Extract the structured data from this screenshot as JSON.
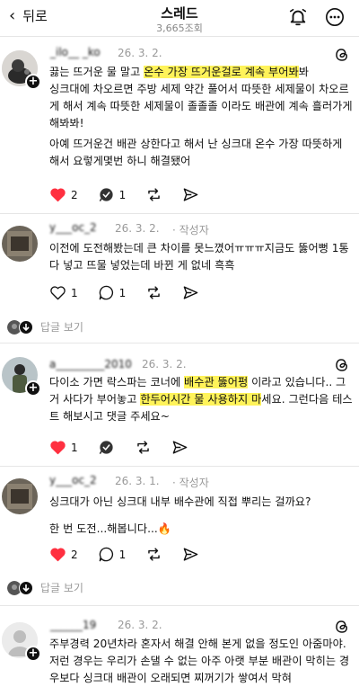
{
  "header": {
    "back_label": "뒤로",
    "title": "스레드",
    "views": "3,665조회"
  },
  "posts": [
    {
      "username": "_ilo__ _ko",
      "date": "26. 3. 2.",
      "body_parts": [
        {
          "text": "끓는 뜨거운 물 말고 온수 가장 뜨거운걸로 계속 부어봐봐",
          "highlight_from": "온수 가장 뜨거운걸로 계속 부어봐"
        },
        {
          "text": "싱크대에 차오르면 주방 세제 약간 풀어서 따뜻한 세제물이 차오르게 해서 계속 따뜻한 세제물이 졸졸졸 이라도 배관에 계속 흘러가게 해봐봐!"
        },
        {
          "text": "아예 뜨거운건 배관 상한다고 해서 난 싱크대 온수 가장 따뜻하게 해서 요렇게몇번 하니 해결됐어"
        }
      ],
      "likes": "2",
      "replies_count": "1"
    },
    {
      "username": "y___oc_2",
      "date": "26. 3. 2.",
      "author_tag": "· 작성자",
      "body_parts": [
        {
          "text": "이전에 도전해봤는데 큰 차이를 못느꼈어ㅠㅠㅠ지금도 뚫어뻥 1통 다 넣고 뜨물 넣었는데 바뀐 게 없네 흑흑"
        }
      ],
      "likes": "1",
      "replies_count": "1",
      "replies_label": "답글 보기"
    },
    {
      "username": "a_________2010",
      "date": "26. 3. 2.",
      "body_parts": [
        {
          "text": "다이소 가면 락스파는 코너에 배수관 뚫어펑 이라고 있습니다.. 그거 사다가 부어놓고 한두어시간 물 사용하지 마세요. 그런다음 테스트 해보시고 댓글 주세요~"
        }
      ],
      "highlights": [
        "배수관 뚫어펑",
        "한두어시간 물 사용하지 마"
      ],
      "likes": "1"
    },
    {
      "username": "y___oc_2",
      "date": "26. 3. 1.",
      "author_tag": "· 작성자",
      "body_parts": [
        {
          "text": "싱크대가 아닌 싱크대 내부 배수관에 직접 뿌리는 걸까요?"
        },
        {
          "text": "한 번 도전...해봅니다...🔥"
        }
      ],
      "likes": "2",
      "replies_count": "1",
      "replies_label": "답글 보기"
    },
    {
      "username": "______19",
      "date": "26. 3. 2.",
      "body_parts": [
        {
          "text": "주부경력 20년차라 혼자서 해결 안해 본게 없을 정도인 아줌마야. 저런 경우는 우리가 손댈 수 없는 아주 아랫 부분 배관이 막히는 경우보다 싱크대 배관이 오래되면 찌꺼기가 쌓여서 막혀"
        }
      ]
    }
  ],
  "colors": {
    "highlight": "#fff35a",
    "like_red": "#ff3040",
    "muted": "#9a9a9a"
  },
  "icons": [
    "bell-icon",
    "more-icon",
    "heart-icon",
    "comment-icon",
    "repost-icon",
    "share-icon",
    "threads-logo-icon",
    "plus-icon"
  ]
}
